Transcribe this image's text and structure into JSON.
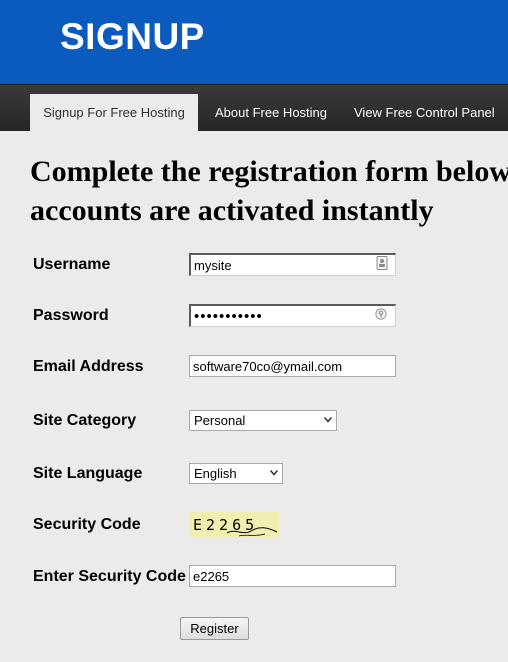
{
  "header": {
    "title": "SIGNUP"
  },
  "nav": {
    "tabs": [
      {
        "label": "Signup For Free Hosting",
        "active": true
      },
      {
        "label": "About Free Hosting",
        "active": false
      },
      {
        "label": "View Free Control Panel",
        "active": false
      }
    ]
  },
  "heading": {
    "line1": "Complete the registration form below",
    "line2": "accounts are activated instantly"
  },
  "form": {
    "username": {
      "label": "Username",
      "value": "mysite"
    },
    "password": {
      "label": "Password",
      "value": "•••••••••••"
    },
    "email": {
      "label": "Email Address",
      "value": "software70co@ymail.com"
    },
    "category": {
      "label": "Site Category",
      "value": "Personal"
    },
    "language": {
      "label": "Site Language",
      "value": "English"
    },
    "security": {
      "label": "Security Code",
      "captcha": "E2265"
    },
    "enter_security": {
      "label": "Enter Security Code",
      "value": "e2265"
    },
    "submit_label": "Register"
  },
  "colors": {
    "header_bg": "#0a5bbd",
    "nav_bg": "#2f2f2f",
    "page_bg": "#ebebeb",
    "captcha_bg": "#f2eeb0"
  },
  "icons": {
    "username_field": "user-card-icon",
    "password_field": "key-icon",
    "select_caret": "chevron-down-icon"
  }
}
